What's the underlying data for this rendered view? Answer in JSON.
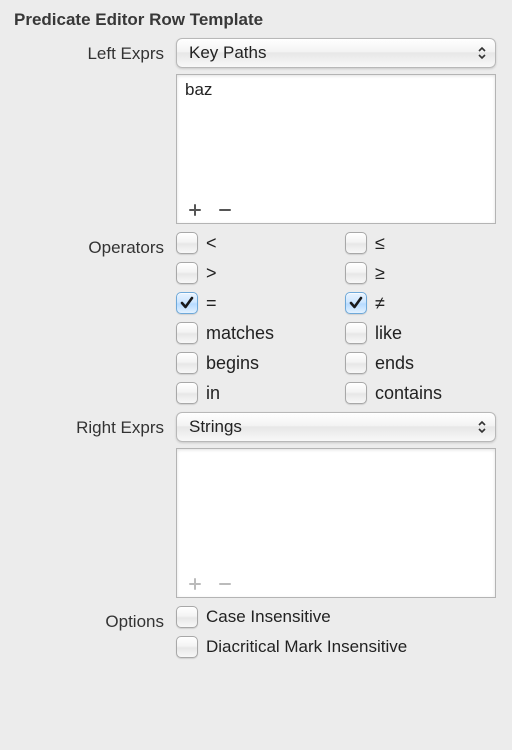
{
  "title": "Predicate Editor Row Template",
  "leftExprs": {
    "label": "Left Exprs",
    "popup": "Key Paths",
    "items": [
      "baz"
    ]
  },
  "operators": {
    "label": "Operators",
    "list": [
      {
        "symbol": "<",
        "checked": false
      },
      {
        "symbol": "≤",
        "checked": false
      },
      {
        "symbol": ">",
        "checked": false
      },
      {
        "symbol": "≥",
        "checked": false
      },
      {
        "symbol": "=",
        "checked": true
      },
      {
        "symbol": "≠",
        "checked": true
      },
      {
        "symbol": "matches",
        "checked": false
      },
      {
        "symbol": "like",
        "checked": false
      },
      {
        "symbol": "begins",
        "checked": false
      },
      {
        "symbol": "ends",
        "checked": false
      },
      {
        "symbol": "in",
        "checked": false
      },
      {
        "symbol": "contains",
        "checked": false
      }
    ]
  },
  "rightExprs": {
    "label": "Right Exprs",
    "popup": "Strings"
  },
  "options": {
    "label": "Options",
    "list": [
      {
        "label": "Case Insensitive",
        "checked": false
      },
      {
        "label": "Diacritical Mark Insensitive",
        "checked": false
      }
    ]
  }
}
